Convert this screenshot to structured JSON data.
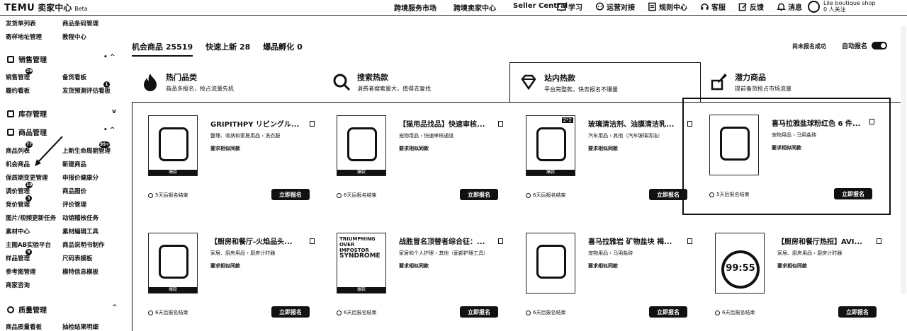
{
  "topbar": {
    "logo": "TEMU",
    "center": "卖家中心",
    "beta": "Beta",
    "nav": [
      "跨境服务市场",
      "跨境卖家中心",
      "Seller Central"
    ],
    "tools": [
      {
        "label": "学习",
        "icon": "book-icon"
      },
      {
        "label": "运营对接",
        "icon": "chat-icon"
      },
      {
        "label": "规则中心",
        "icon": "rules-icon"
      },
      {
        "label": "客服",
        "icon": "headset-icon"
      },
      {
        "label": "反馈",
        "icon": "edit-icon"
      },
      {
        "label": "消息",
        "icon": "bell-icon"
      }
    ],
    "shop_name": "Lile boutique shop",
    "followers": "0 人关注"
  },
  "sidebar": {
    "top_items": [
      {
        "label": "发货单列表"
      },
      {
        "label": "商品条码管理"
      },
      {
        "label": "寄样地址管理"
      },
      {
        "label": "教程中心"
      }
    ],
    "sections": [
      {
        "title": "销售管理",
        "ctrl": "• ^"
      },
      {
        "title": "库存管理",
        "ctrl": "v"
      },
      {
        "title": "商品管理",
        "ctrl": "• ^"
      },
      {
        "title": "质量管理",
        "ctrl": "^"
      }
    ],
    "sales_items": [
      {
        "label": "销售管理",
        "badge": "29"
      },
      {
        "label": "备货看板",
        "badge": ""
      },
      {
        "label": "履约看板",
        "badge": ""
      },
      {
        "label": "发货预测评估看板",
        "badge": "1"
      }
    ],
    "goods_items": [
      {
        "label": "商品列表",
        "badge": "77"
      },
      {
        "label": "上新生命周期管理",
        "badge": "99+"
      },
      {
        "label": "机会商品",
        "badge": ""
      },
      {
        "label": "新建商品",
        "badge": ""
      },
      {
        "label": "保质期变更管理",
        "badge": ""
      },
      {
        "label": "申报价健康分",
        "badge": ""
      },
      {
        "label": "调价管理",
        "badge": "10"
      },
      {
        "label": "商品图价",
        "badge": ""
      },
      {
        "label": "竞价管理",
        "badge": "3"
      },
      {
        "label": "评价管理",
        "badge": ""
      },
      {
        "label": "图片/视频更新任务",
        "badge": ""
      },
      {
        "label": "动销稽核任务",
        "badge": ""
      },
      {
        "label": "素材中心",
        "badge": ""
      },
      {
        "label": "素材编辑工具",
        "badge": ""
      },
      {
        "label": "主图AB实验平台",
        "badge": ""
      },
      {
        "label": "商品说明书制作",
        "badge": ""
      },
      {
        "label": "样品管理",
        "badge": "9"
      },
      {
        "label": "尺码表模板",
        "badge": ""
      },
      {
        "label": "参考图管理",
        "badge": ""
      },
      {
        "label": "模特信息模板",
        "badge": ""
      },
      {
        "label": "商家咨询",
        "badge": ""
      }
    ],
    "quality_items": [
      {
        "label": "商品质量看板"
      },
      {
        "label": "抽检结果明细"
      }
    ]
  },
  "summary": {
    "tabs": [
      {
        "label": "机会商品 25519"
      },
      {
        "label": "快速上新 28"
      },
      {
        "label": "爆品孵化 0"
      }
    ],
    "right_note": "尚未报名成功",
    "auto_label": "自动报名"
  },
  "tabs": [
    {
      "title": "热门品类",
      "sub": "商品多报名，抢占流量先机",
      "icon": "flame-icon"
    },
    {
      "title": "搜索热款",
      "sub": "消费者搜索量大，值得去复找",
      "icon": "search-icon"
    },
    {
      "title": "站内热款",
      "sub": "平台完整款，快去报名不爆量",
      "icon": "diamond-icon"
    },
    {
      "title": "潜力商品",
      "sub": "提前备货抢占市场流量",
      "icon": "rocket-icon"
    }
  ],
  "cards": [
    {
      "title": "GRIPITHPY リビングル...",
      "desc": "整理、收纳和家居用品 › 洗衣服",
      "link": "要求相似同款",
      "time": "5天后报名结束",
      "btn": "立即报名",
      "band": "爆款"
    },
    {
      "title": "【猫用品找品】快速审核...",
      "desc": "宠物用品 › 快速审核通道",
      "link": "要求相似同款",
      "time": "6天后报名结束",
      "btn": "立即报名",
      "band": "爆款"
    },
    {
      "title": "玻璃清洁剂、油膜清洁乳...",
      "desc": "汽车用品 › 其他（汽车玻璃清洁）",
      "link": "要求相似同款",
      "time": "6天后报名结束",
      "btn": "立即报名",
      "band": "爆款",
      "tag": "2*2"
    },
    {
      "title": "喜马拉雅盐球粉红色 6 件...",
      "desc": "宠物用品 › 马用盐砖",
      "link": "要求相似同款",
      "time": "5天后报名结束",
      "btn": "立即报名",
      "band": ""
    },
    {
      "title": "【厨房和餐厅-火焰品头...",
      "desc": "家居、厨房用品 › 厨房计时器",
      "link": "要求相似同款",
      "time": "6天后报名结束",
      "btn": "立即报名",
      "band": "爆款"
    },
    {
      "title": "战胜冒名顶替者综合征：...",
      "desc": "家居和个人护理 › 其他（面部护理工具）",
      "link": "要求相似同款",
      "time": "6天后报名结束",
      "btn": "立即报名",
      "band": "爆款",
      "art": [
        "TRIUMPHING",
        "OVER IMPOSTOR",
        "SYNDROME"
      ]
    },
    {
      "title": "喜马拉雅岩 矿物盐块 褐...",
      "desc": "宠物用品 › 马用盐砖",
      "link": "要求相似同款",
      "time": "6天后报名结束",
      "btn": "立即报名",
      "band": ""
    },
    {
      "title": "【厨房和餐厅热招】AVI...",
      "desc": "家居、厨房用品 › 厨房计时器",
      "link": "要求相似同款",
      "time": "6天后报名结束",
      "btn": "立即报名",
      "band": "",
      "art_num": "99:55"
    }
  ]
}
